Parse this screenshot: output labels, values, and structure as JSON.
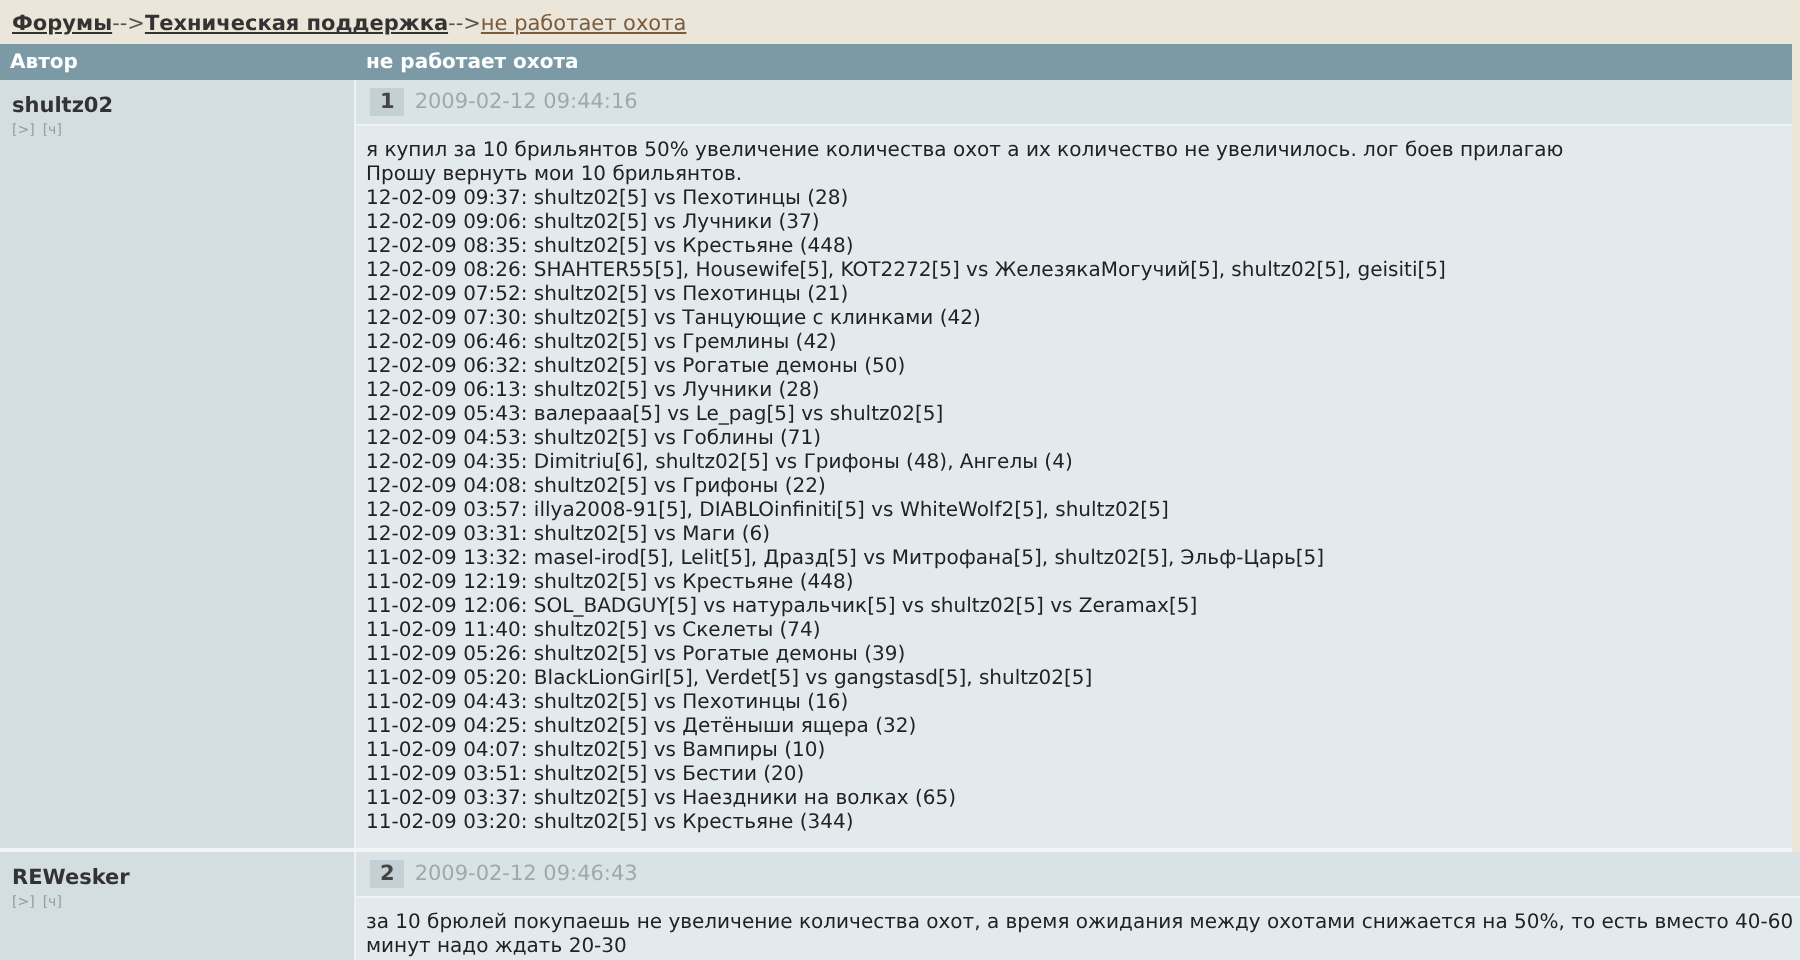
{
  "breadcrumb": [
    {
      "label": "Форумы",
      "current": false
    },
    {
      "label": "Техническая поддержка",
      "current": false
    },
    {
      "label": "не работает охота",
      "current": true
    }
  ],
  "breadcrumb_separator": "-->",
  "table": {
    "columns": [
      "Автор",
      "не работает охота"
    ],
    "posts": [
      {
        "author": "shultz02",
        "author_links": [
          "[>]",
          "[ч]"
        ],
        "number": "1",
        "date": "2009-02-12 09:44:16",
        "lines": [
          "я купил за 10 брильянтов 50% увеличение количества охот а их количество не увеличилось. лог боев прилагаю",
          "Прошу вернуть мои 10 брильянтов.",
          "12-02-09 09:37: shultz02[5] vs Пехотинцы (28)",
          "12-02-09 09:06: shultz02[5] vs Лучники (37)",
          "12-02-09 08:35: shultz02[5] vs Крестьяне (448)",
          "12-02-09 08:26: SHAHTER55[5], Housewife[5], KOT2272[5] vs ЖелезякаМогучий[5], shultz02[5], geisiti[5]",
          "12-02-09 07:52: shultz02[5] vs Пехотинцы (21)",
          "12-02-09 07:30: shultz02[5] vs Танцующие с клинками (42)",
          "12-02-09 06:46: shultz02[5] vs Гремлины (42)",
          "12-02-09 06:32: shultz02[5] vs Рогатые демоны (50)",
          "12-02-09 06:13: shultz02[5] vs Лучники (28)",
          "12-02-09 05:43: валерааа[5] vs Le_pag[5] vs shultz02[5]",
          "12-02-09 04:53: shultz02[5] vs Гоблины (71)",
          "12-02-09 04:35: Dimitriu[6], shultz02[5] vs Грифоны (48), Ангелы (4)",
          "12-02-09 04:08: shultz02[5] vs Грифоны (22)",
          "12-02-09 03:57: illya2008-91[5], DIABLOinfiniti[5] vs WhiteWolf2[5], shultz02[5]",
          "12-02-09 03:31: shultz02[5] vs Маги (6)",
          "11-02-09 13:32: masel-irod[5], Lelit[5], Дразд[5] vs Митрофана[5], shultz02[5], Эльф-Царь[5]",
          "11-02-09 12:19: shultz02[5] vs Крестьяне (448)",
          "11-02-09 12:06: SOL_BADGUY[5] vs натуральчик[5] vs shultz02[5] vs Zeramax[5]",
          "11-02-09 11:40: shultz02[5] vs Скелеты (74)",
          "11-02-09 05:26: shultz02[5] vs Рогатые демоны (39)",
          "11-02-09 05:20: BlackLionGirl[5], Verdet[5] vs gangstasd[5], shultz02[5]",
          "11-02-09 04:43: shultz02[5] vs Пехотинцы (16)",
          "11-02-09 04:25: shultz02[5] vs Детёныши ящера (32)",
          "11-02-09 04:07: shultz02[5] vs Вампиры (10)",
          "11-02-09 03:51: shultz02[5] vs Бестии (20)",
          "11-02-09 03:37: shultz02[5] vs Наездники на волках (65)",
          "11-02-09 03:20: shultz02[5] vs Крестьяне (344)"
        ]
      },
      {
        "author": "REWesker",
        "author_links": [
          "[>]",
          "[ч]"
        ],
        "number": "2",
        "date": "2009-02-12 09:46:43",
        "lines": [
          "за 10 брюлей покупаешь не увеличение количества охот, а время ожидания между охотами снижается на 50%, то есть вместо 40-60",
          "минут надо ждать 20-30"
        ]
      }
    ]
  }
}
